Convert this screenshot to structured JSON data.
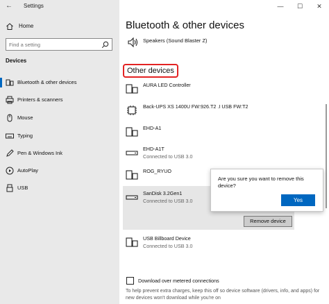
{
  "window": {
    "title": "Settings",
    "back_glyph": "←",
    "minimize_glyph": "—",
    "maximize_glyph": "☐",
    "close_glyph": "✕"
  },
  "sidebar": {
    "home_label": "Home",
    "search_placeholder": "Find a setting",
    "section_label": "Devices",
    "items": [
      {
        "label": "Bluetooth & other devices",
        "icon": "bluetooth-devices-icon",
        "active": true
      },
      {
        "label": "Printers & scanners",
        "icon": "printer-icon"
      },
      {
        "label": "Mouse",
        "icon": "mouse-icon"
      },
      {
        "label": "Typing",
        "icon": "keyboard-icon"
      },
      {
        "label": "Pen & Windows Ink",
        "icon": "pen-icon"
      },
      {
        "label": "AutoPlay",
        "icon": "autoplay-icon"
      },
      {
        "label": "USB",
        "icon": "usb-icon"
      }
    ]
  },
  "main": {
    "title": "Bluetooth & other devices",
    "speaker": {
      "name": "Speakers (Sound Blaster Z)",
      "icon": "speaker-icon"
    },
    "other_devices_header": "Other devices",
    "devices": [
      {
        "name": "AURA LED Controller",
        "status": "",
        "icon": "keyboard-device-icon"
      },
      {
        "name": "Back-UPS XS 1400U  FW:926.T2 .I USB FW:T2",
        "status": "",
        "icon": "chip-icon"
      },
      {
        "name": "EHD-A1",
        "status": "",
        "icon": "keyboard-device-icon"
      },
      {
        "name": "EHD-A1T",
        "status": "Connected to USB 3.0",
        "icon": "drive-icon"
      },
      {
        "name": "ROG_RYUO",
        "status": "",
        "icon": "keyboard-device-icon"
      },
      {
        "name": "SanDisk 3.2Gen1",
        "status": "Connected to USB 3.0",
        "icon": "drive-icon"
      },
      {
        "name": "USB Billboard Device",
        "status": "Connected to USB 3.0",
        "icon": "keyboard-device-icon"
      }
    ],
    "remove_button": "Remove device",
    "metered_label": "Download over metered connections",
    "metered_checked": false,
    "help_text": "To help prevent extra charges, keep this off so device software (drivers, info, and apps) for new devices won't download while you're on"
  },
  "popup": {
    "message": "Are you sure you want to remove this device?",
    "yes_label": "Yes"
  },
  "colors": {
    "accent": "#0067c0",
    "highlight_border": "#e32222",
    "sidebar_bg": "#e9e9e9"
  }
}
